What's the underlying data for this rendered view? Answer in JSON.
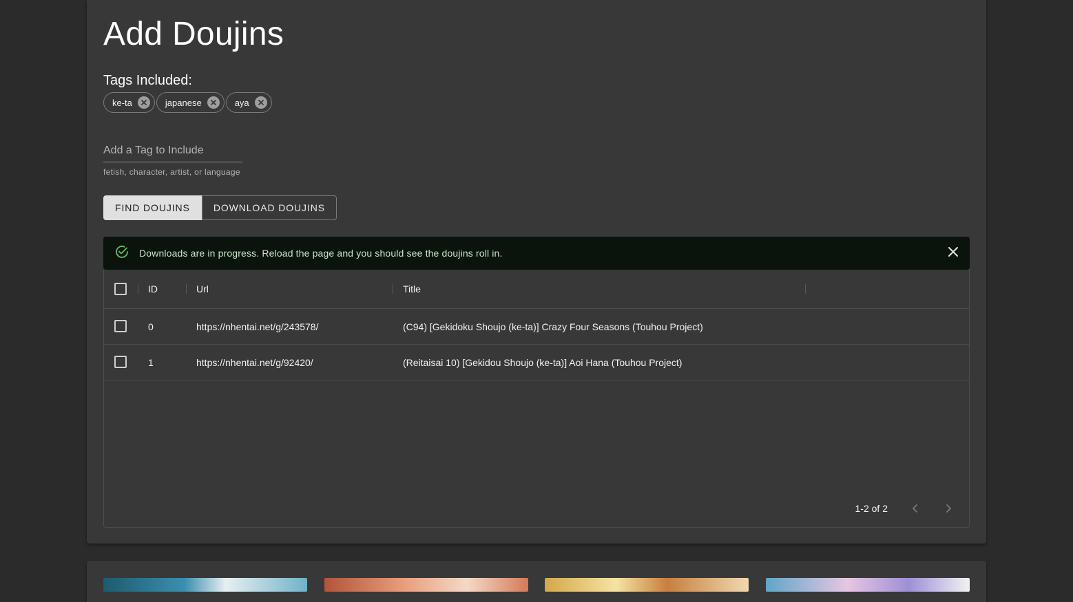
{
  "page": {
    "title": "Add Doujins"
  },
  "tags": {
    "heading": "Tags Included:",
    "chips": [
      {
        "label": "ke-ta"
      },
      {
        "label": "japanese"
      },
      {
        "label": "aya"
      }
    ]
  },
  "tag_input": {
    "placeholder": "Add a Tag to Include",
    "value": "",
    "helper": "fetish, character, artist, or language"
  },
  "buttons": {
    "find": "FIND DOUJINS",
    "download": "DOWNLOAD DOUJINS"
  },
  "alert": {
    "message": "Downloads are in progress. Reload the page and you should see the doujins roll in.",
    "color": "#0b140c",
    "icon_color": "#66bb6a"
  },
  "grid": {
    "columns": {
      "id": "ID",
      "url": "Url",
      "title": "Title"
    },
    "rows": [
      {
        "id": "0",
        "url": "https://nhentai.net/g/243578/",
        "title": "(C94) [Gekidoku Shoujo (ke-ta)] Crazy Four Seasons (Touhou Project)"
      },
      {
        "id": "1",
        "url": "https://nhentai.net/g/92420/",
        "title": "(Reitaisai 10) [Gekidou Shoujo (ke-ta)] Aoi Hana (Touhou Project)"
      }
    ],
    "pagination": "1-2 of 2"
  },
  "icons": {
    "chip_delete": "cancel-circle-icon",
    "alert": "check-circle-outline-icon",
    "alert_close": "close-icon",
    "prev": "chevron-left-icon",
    "next": "chevron-right-icon"
  }
}
